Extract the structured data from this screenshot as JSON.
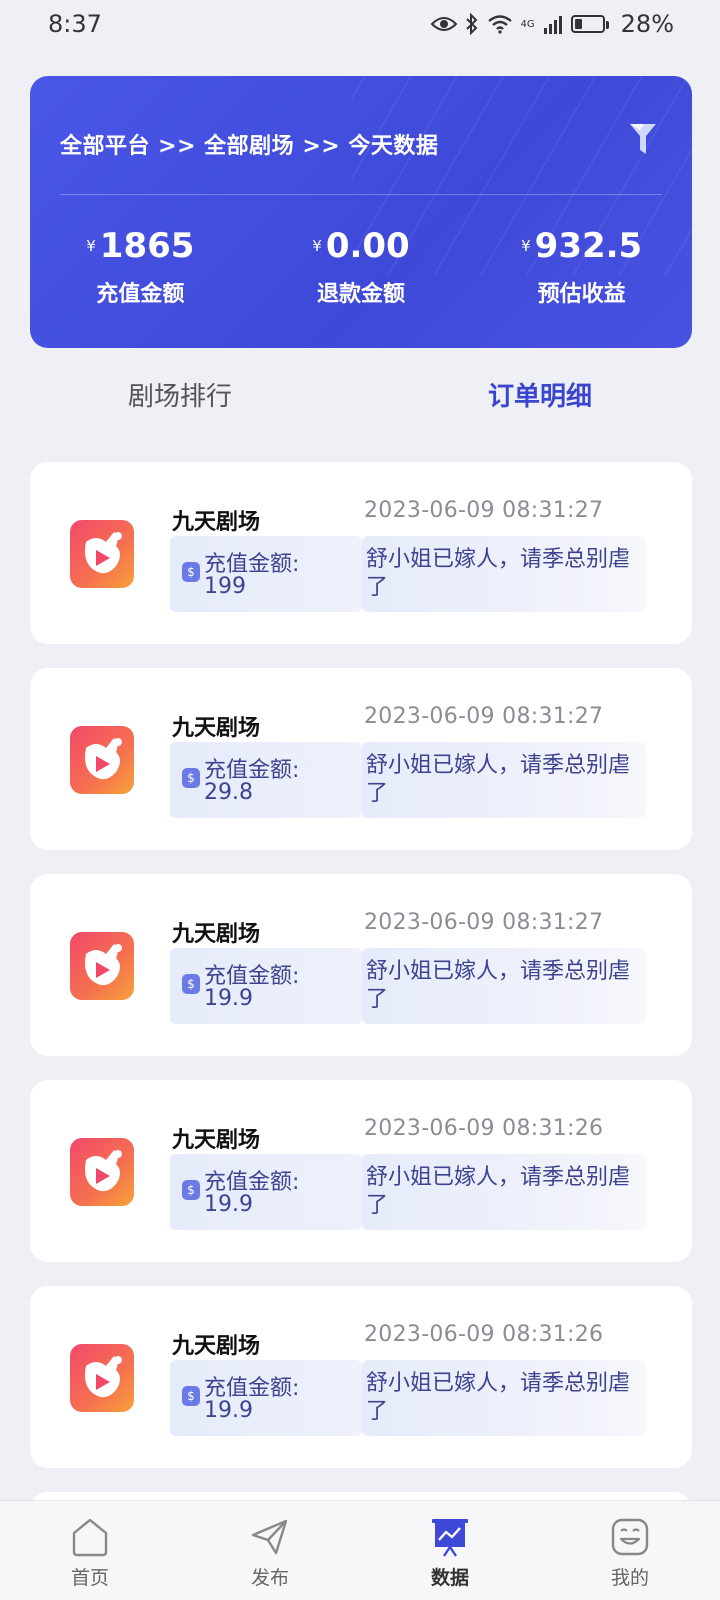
{
  "status_bar": {
    "time": "8:37",
    "network": "4G",
    "battery": "28%",
    "battery_level_percent": 28
  },
  "summary": {
    "breadcrumb": "全部平台 >> 全部剧场 >> 今天数据",
    "currency_symbol": "¥",
    "stats": [
      {
        "value": "1865",
        "label": "充值金额"
      },
      {
        "value": "0.00",
        "label": "退款金额"
      },
      {
        "value": "932.5",
        "label": "预估收益"
      }
    ]
  },
  "tabs": [
    {
      "label": "剧场排行",
      "active": false
    },
    {
      "label": "订单明细",
      "active": true
    }
  ],
  "orders": [
    {
      "theater": "九天剧场",
      "time": "2023-06-09 08:31:27",
      "amount_label": "充值金额:",
      "amount": "199",
      "drama_title": "舒小姐已嫁人，请季总别虐了"
    },
    {
      "theater": "九天剧场",
      "time": "2023-06-09 08:31:27",
      "amount_label": "充值金额:",
      "amount": "29.8",
      "drama_title": "舒小姐已嫁人，请季总别虐了"
    },
    {
      "theater": "九天剧场",
      "time": "2023-06-09 08:31:27",
      "amount_label": "充值金额:",
      "amount": "19.9",
      "drama_title": "舒小姐已嫁人，请季总别虐了"
    },
    {
      "theater": "九天剧场",
      "time": "2023-06-09 08:31:26",
      "amount_label": "充值金额:",
      "amount": "19.9",
      "drama_title": "舒小姐已嫁人，请季总别虐了"
    },
    {
      "theater": "九天剧场",
      "time": "2023-06-09 08:31:26",
      "amount_label": "充值金额:",
      "amount": "19.9",
      "drama_title": "舒小姐已嫁人，请季总别虐了"
    }
  ],
  "bottom_nav": [
    {
      "label": "首页",
      "icon": "home-icon",
      "active": false
    },
    {
      "label": "发布",
      "icon": "send-icon",
      "active": false
    },
    {
      "label": "数据",
      "icon": "chart-board-icon",
      "active": true
    },
    {
      "label": "我的",
      "icon": "smile-face-icon",
      "active": false
    }
  ],
  "colors": {
    "accent": "#3f49d8",
    "active_tab": "#3a46cf",
    "page_bg": "#eef0f6"
  }
}
